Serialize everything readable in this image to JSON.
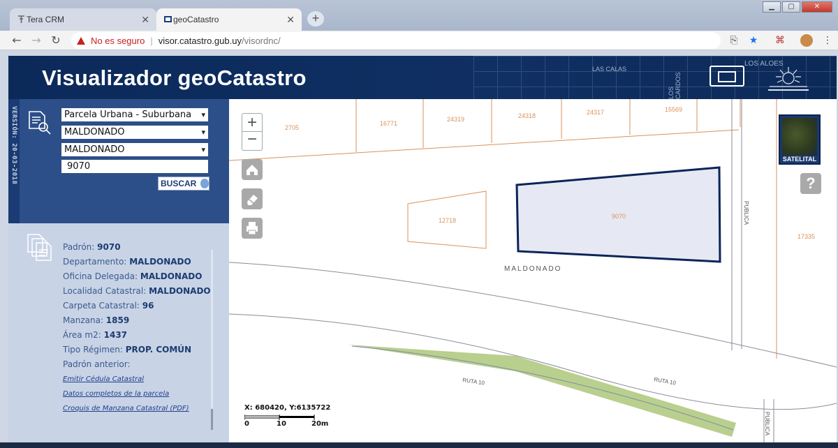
{
  "browser": {
    "tabs": [
      {
        "title": "Tera CRM",
        "active": false
      },
      {
        "title": "geoCatastro",
        "active": true
      }
    ],
    "address": {
      "security_label": "No es seguro",
      "host": "visor.catastro.gub.uy",
      "path": "/visordnc/"
    }
  },
  "header": {
    "title": "Visualizador geoCatastro",
    "background_labels": [
      "LOS ALOES",
      "LAS CALAS",
      "LOS CARDOS"
    ]
  },
  "version_label": "VERSIÓN: 20-03-2018",
  "search": {
    "type_select": "Parcela Urbana - Suburbana",
    "department_select": "MALDONADO",
    "locality_select": "MALDONADO",
    "padron_value": "9070",
    "search_button": "BUSCAR"
  },
  "info": {
    "rows": [
      {
        "label": "Padrón:",
        "value": "9070"
      },
      {
        "label": "Departamento:",
        "value": "MALDONADO"
      },
      {
        "label": "Oficina Delegada:",
        "value": "MALDONADO"
      },
      {
        "label": "Localidad Catastral:",
        "value": "MALDONADO"
      },
      {
        "label": "Carpeta Catastral:",
        "value": "96"
      },
      {
        "label": "Manzana:",
        "value": "1859"
      },
      {
        "label": "Área m2:",
        "value": "1437"
      },
      {
        "label": "Tipo Régimen:",
        "value": "PROP. COMÚN"
      },
      {
        "label": "Padrón anterior:",
        "value": ""
      }
    ],
    "links": [
      "Emitir Cédula Catastral",
      "Datos completos de la parcela",
      "Croquis de Manzana Catastral (PDF)"
    ]
  },
  "map": {
    "zoom_in": "+",
    "zoom_out": "−",
    "satellite_label": "SATELITAL",
    "help_label": "?",
    "parcel_labels": [
      "2705",
      "16771",
      "24319",
      "24318",
      "24317",
      "15569",
      "12718",
      "9070",
      "17335"
    ],
    "area_label": "MALDONADO",
    "street_labels": [
      "PUBLICA",
      "RUTA 10",
      "RUTA 10",
      "PUBLICA"
    ],
    "coords_label": "X: 680420, Y:6135722",
    "scale_labels": [
      "0",
      "10",
      "20m"
    ],
    "colors": {
      "parcel_line": "#d9925a",
      "selected_fill": "#e6e9f3",
      "selected_stroke": "#0c2458",
      "green_strip": "#b9cf8e"
    }
  }
}
